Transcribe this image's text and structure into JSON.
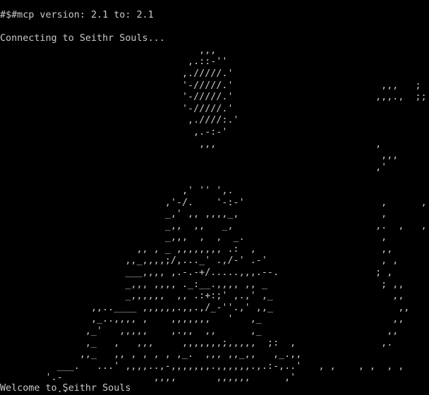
{
  "terminal": {
    "version_line": "#$#mcp version: 2.1 to: 2.1",
    "connecting_line": "Connecting to Seithr Souls...",
    "ascii_art": "                                   ,,,\n                                 ,.::-''\n                                ,./////.'\n                                '-/////.'                          ,,,   ;\n                                '-/////.'                         ,,,.,  ;;\n                                '-/////.'\n                                 ,.////:.'\n                                  ,.-:-'\n                                   ,,,                            ,\n                                                                   ,,,\n                                                                  ,'\n\n                                ,' '' ',.\n                             ,'-/.    '-:-'                        ,      ,     ,\n                             _,' ,, ,,,,_,                         ,\n                             _,,  ,,   _,                         ,.  ,   ,    ,.\n                             _,,,  ,  ,  _.                        ,\n                        ,, , _ ,,,,,,,, .:  ,                      ,,\n                      ,,_,,,,;/,..._' .,/-' .-'                    , ,\n                      ___,,,, ,.-.-+/.....,,,.--.                 ; ,\n                      _,,, ,,,, ._:__.,,,, ,, _                    ; ,,\n                      _,,,,,,  ,, .:+:;' ,.,' ,_                     ,,     ,\n                ,,..____ ,,,,,,.,,.,/_-''.,' ,,_                      ,,     ,\n                ,_..,,,, ,    ,,,,,,,   '   ,_                       ,,\n               ,_'   ,,,,,    ,.,,  ,,      ,_                      ,,\n               ,_   ,   ,,,     ,,,,,,,;,,,,,  ;:  ,               ,.\n              ,,_   ,, , , , , ,_.  ,,, ,,_,,   ,_.,,\n          ___.   ...' ,,,,..,-,,,,,,,.,,,,,,.,.:-,..'   , ,    , ,  , ,\n        '.-                ,,,,       ,,,,,,      ,'\n          .."
  },
  "welcome": {
    "text": "Welcome to Seithr Souls"
  }
}
